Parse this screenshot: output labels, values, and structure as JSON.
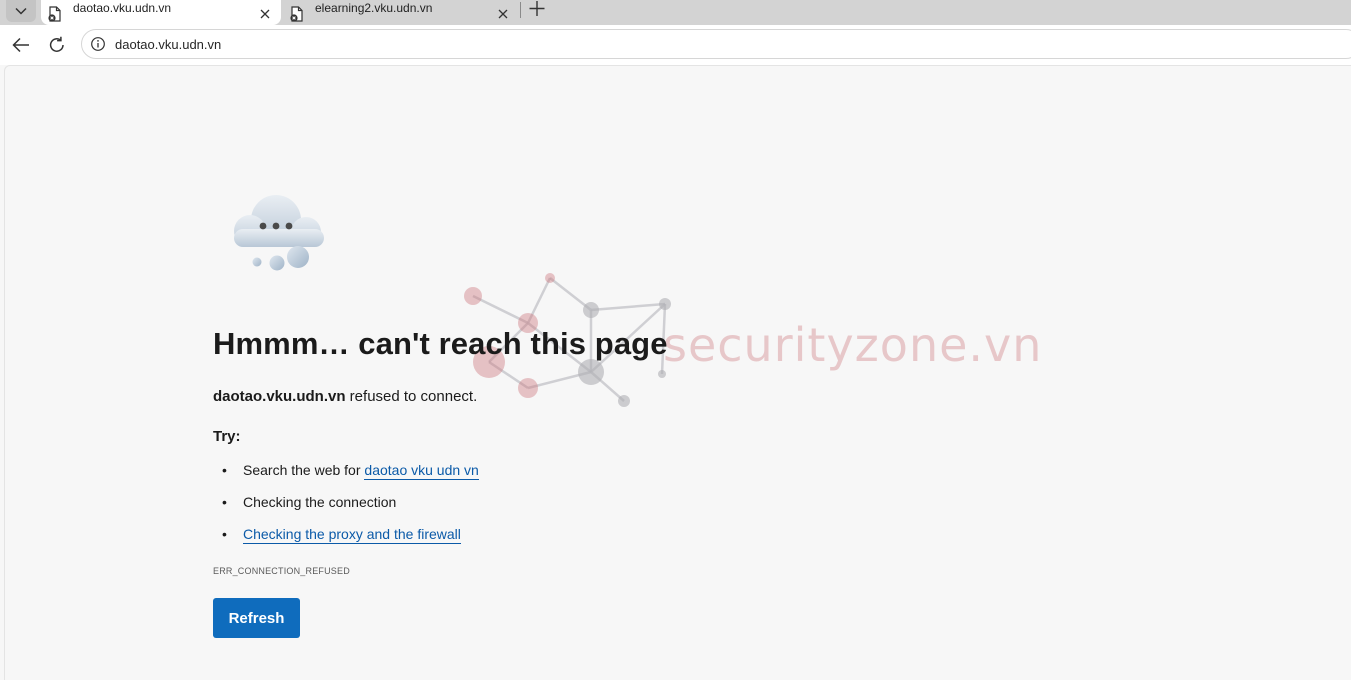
{
  "browser": {
    "tabs": [
      {
        "title": "daotao.vku.udn.vn",
        "active": true,
        "favicon": "blocked-page-icon"
      },
      {
        "title": "elearning2.vku.udn.vn",
        "active": false,
        "favicon": "blocked-page-icon"
      }
    ],
    "address": "daotao.vku.udn.vn"
  },
  "error_page": {
    "headline": "Hmmm… can't reach this page",
    "host": "daotao.vku.udn.vn",
    "message": " refused to connect.",
    "try_label": "Try:",
    "suggestions": [
      {
        "prefix": "Search the web for ",
        "link": "daotao vku udn vn"
      },
      {
        "text": "Checking the connection"
      },
      {
        "link": "Checking the proxy and the firewall"
      }
    ],
    "error_code": "ERR_CONNECTION_REFUSED",
    "refresh_label": "Refresh"
  },
  "watermark": {
    "text": "securityzone.vn"
  },
  "colors": {
    "accent": "#0f6cbd",
    "link": "#0b5aa8",
    "page_background": "#f7f7f7",
    "tabstrip": "#d3d3d3",
    "watermark": "#ce787e"
  }
}
